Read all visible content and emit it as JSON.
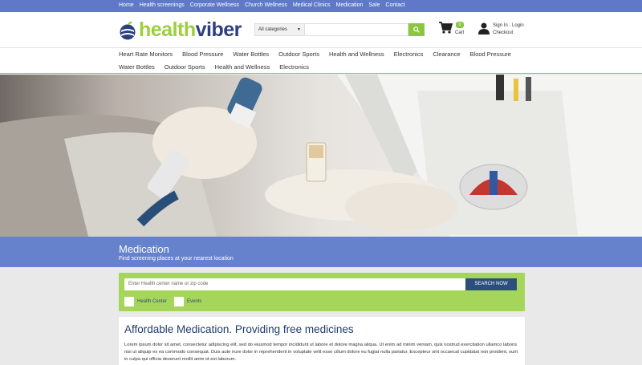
{
  "topnav": [
    "Home",
    "Health screenings",
    "Corporate Wellness",
    "Church Wellness",
    "Medical Clinics",
    "Medication",
    "Sale",
    "Contact"
  ],
  "logo": {
    "part1": "health",
    "part2": "viber"
  },
  "search": {
    "category_label": "All categories",
    "placeholder": ""
  },
  "cart": {
    "count": "0",
    "label": "Cart"
  },
  "account": {
    "signin": "Sign In · Login",
    "checkout": "Checkout"
  },
  "categories_row1": [
    "Heart Rate Monitors",
    "Blood Pressure",
    "Water Bottles",
    "Outdoor Sports",
    "Health and Wellness",
    "Electronics",
    "Clearance",
    "Blood Pressure"
  ],
  "categories_row2": [
    "Water Bottles",
    "Outdoor Sports",
    "Health and Wellness",
    "Electronics"
  ],
  "banner": {
    "title": "Medication",
    "subtitle": "Find screening places at your nearest location"
  },
  "finder": {
    "placeholder": "Enter Health center name or zip code",
    "button": "SEARCH NOW",
    "check1": "Health Center",
    "check2": "Events"
  },
  "article": {
    "title": "Affordable Medication. Providing free medicines",
    "body": "Lorem ipsum dolor sit amet, consectetur adipiscing elit, sed do eiusmod tempor incididunt ut labore et dolore magna aliqua. Ut enim ad minim veniam, quis nostrud exercitation ullamco laboris nisi ut aliquip ex ea commodo consequat. Duis aute irure dolor in reprehenderit in voluptate velit esse cillum dolore eu fugiat nulla pariatur. Excepteur sint occaecat cupidatat non proident, sunt in culpa qui officia deserunt mollit anim id est laborum."
  },
  "colors": {
    "topbar": "#5f79c8",
    "accent_green": "#8cc63f",
    "banner": "#6682cc",
    "navy": "#2c4e7d"
  }
}
